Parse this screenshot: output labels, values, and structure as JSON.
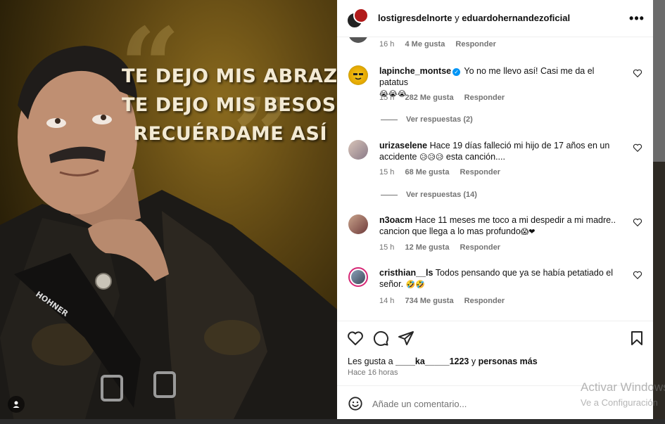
{
  "post_image": {
    "lyrics": [
      "TE DEJO MIS ABRAZOS",
      "TE DEJO MIS BESOS",
      "RECUÉRDAME ASÍ"
    ],
    "brand_text": "HOHNER"
  },
  "header": {
    "account_one": "lostigresdelnorte",
    "conjunction": " y ",
    "account_two": "eduardohernandezoficial",
    "more_label": "•••"
  },
  "comments": [
    {
      "time": "16 h",
      "likes": "4 Me gusta",
      "reply": "Responder"
    },
    {
      "user": "lapinche_montse",
      "verified": true,
      "text": "Yo no me llevo así! Casi me da el patatus",
      "emojis": "😭😭😭",
      "time": "15 h",
      "likes": "282 Me gusta",
      "reply": "Responder",
      "view_replies": "Ver respuestas (2)"
    },
    {
      "user": "urizaselene",
      "text": "Hace 19 días falleció mi hijo de 17 años en un accidente",
      "emojis": "😥😥😥",
      "text_after": " esta canción....",
      "time": "15 h",
      "likes": "68 Me gusta",
      "reply": "Responder",
      "view_replies": "Ver respuestas (14)"
    },
    {
      "user": "n3oacm",
      "text": "Hace 11 meses me toco a mi despedir a mi madre.. cancion que llega a lo mas profundo",
      "emojis": "😱❤",
      "time": "15 h",
      "likes": "12 Me gusta",
      "reply": "Responder"
    },
    {
      "user": "cristhian__ls",
      "text": "Todos pensando que ya se había petatiado el señor.",
      "emojis": "🤣🤣",
      "time": "14 h",
      "likes": "734 Me gusta",
      "reply": "Responder"
    }
  ],
  "actions": {
    "likes_prefix": "Les gusta a ",
    "liked_by": "____ka_____1223",
    "likes_middle": " y ",
    "likes_suffix": "personas más",
    "time_ago": "Hace 16 horas"
  },
  "add_comment": {
    "placeholder": "Añade un comentario..."
  },
  "watermark": {
    "title": "Activar Windows",
    "subtitle": "Ve a Configuración"
  },
  "colors": {
    "link_blue": "#0095f6",
    "meta_gray": "#737373",
    "heart_red": "#ed4956"
  }
}
